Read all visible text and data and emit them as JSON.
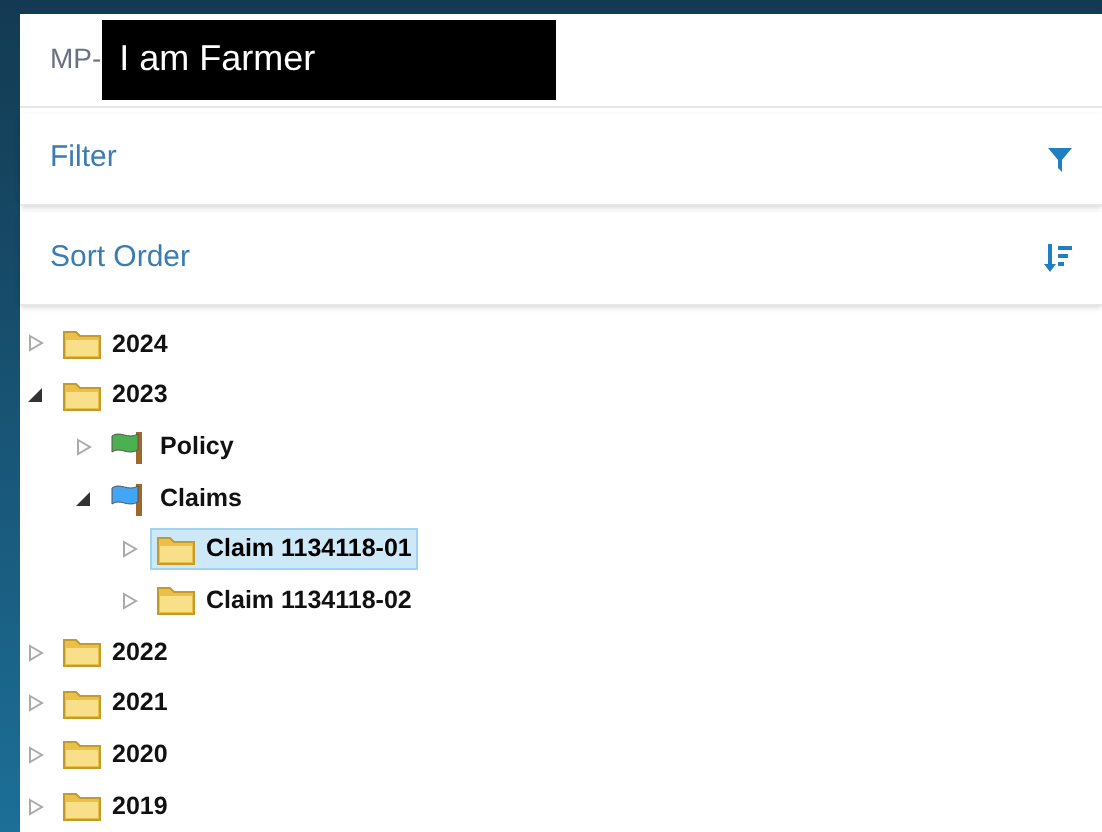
{
  "header": {
    "prefix": "MP-",
    "label": "I am Farmer"
  },
  "filter": {
    "label": "Filter"
  },
  "sort": {
    "label": "Sort Order"
  },
  "tree": [
    {
      "label": "2024",
      "kind": "folder",
      "expanded": false,
      "selected": false
    },
    {
      "label": "2023",
      "kind": "folder",
      "expanded": true,
      "selected": false,
      "children": [
        {
          "label": "Policy",
          "kind": "flag",
          "color": "#4caf50",
          "expanded": false,
          "selected": false
        },
        {
          "label": "Claims",
          "kind": "flag",
          "color": "#42a5f5",
          "expanded": true,
          "selected": false,
          "children": [
            {
              "label": "Claim 1134118-01",
              "kind": "folder",
              "expanded": false,
              "selected": true
            },
            {
              "label": "Claim 1134118-02",
              "kind": "folder",
              "expanded": false,
              "selected": false
            }
          ]
        }
      ]
    },
    {
      "label": "2022",
      "kind": "folder",
      "expanded": false,
      "selected": false
    },
    {
      "label": "2021",
      "kind": "folder",
      "expanded": false,
      "selected": false
    },
    {
      "label": "2020",
      "kind": "folder",
      "expanded": false,
      "selected": false
    },
    {
      "label": "2019",
      "kind": "folder",
      "expanded": false,
      "selected": false
    }
  ]
}
